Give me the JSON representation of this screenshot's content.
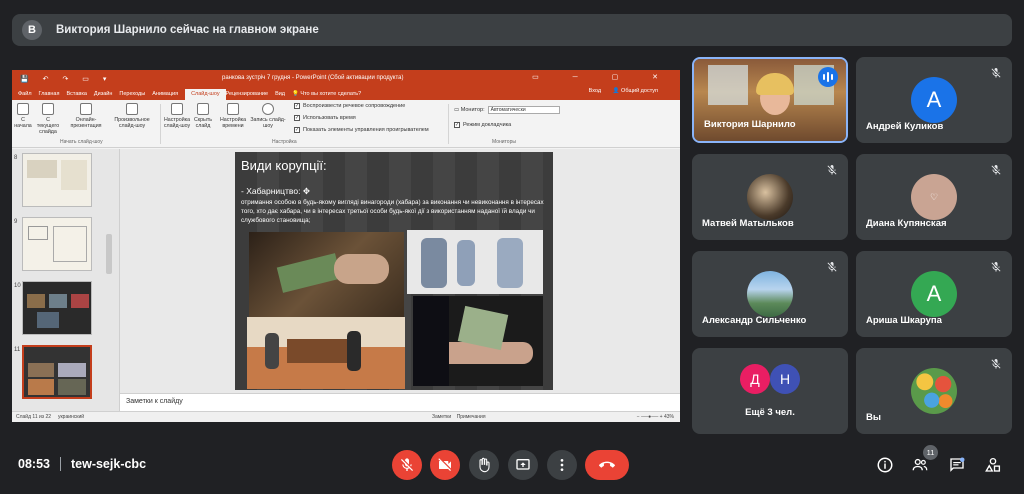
{
  "banner": {
    "avatar_letter": "B",
    "text": "Виктория Шарнило сейчас на главном экране"
  },
  "powerpoint": {
    "title_bar": "ранкова зустріч 7 грудня - PowerPoint (Сбой активации продукта)",
    "tabs": [
      "Файл",
      "Главная",
      "Вставка",
      "Дизайн",
      "Переходы",
      "Анимация",
      "Слайд-шоу",
      "Рецензирование",
      "Вид"
    ],
    "active_tab": "Слайд-шоу",
    "tell_me": "Что вы хотите сделать?",
    "sign_in": "Вход",
    "share": "Общий доступ",
    "ribbon": {
      "btn_start": "С начала",
      "btn_current": "С текущего слайда",
      "btn_online": "Онлайн-презентация",
      "btn_custom": "Произвольное слайд-шоу",
      "group_start": "Начать слайд-шоу",
      "btn_setup": "Настройка слайд-шоу",
      "btn_hide": "Скрыть слайд",
      "btn_timing": "Настройка времени",
      "btn_record": "Запись слайд-шоу",
      "check_narration": "Воспроизвести речевое сопровождение",
      "check_timings": "Использовать время",
      "check_controls": "Показать элементы управления проигрывателем",
      "group_setup": "Настройка",
      "monitor_label": "Монитор:",
      "monitor_value": "Автоматически",
      "check_presenter": "Режим докладчика",
      "group_monitors": "Мониторы"
    },
    "thumb_numbers": [
      "8",
      "9",
      "10",
      "11"
    ],
    "slide": {
      "title": "Види корупції:",
      "bullet": "-   Хабарництво:",
      "body": " отримання особою в будь-якому вигляді винагороди (хабара) за виконання чи невиконання в інтересах того, хто дає хабара, чи в інтересах третьої особи будь-якої дії з використанням наданої  їй влади чи службового становища;"
    },
    "notes": "Заметки к слайду",
    "status": {
      "slide": "Слайд 11 из 22",
      "lang": "украинский",
      "notes_btn": "Заметки",
      "comments_btn": "Примечания",
      "zoom": "43%"
    }
  },
  "participants": [
    {
      "name": "Виктория Шарнило",
      "speaking": true
    },
    {
      "name": "Андрей Куликов",
      "letter": "А",
      "color": "#1a73e8"
    },
    {
      "name": "Матвей Матыльков"
    },
    {
      "name": "Диана Купянская"
    },
    {
      "name": "Александр Сильченко"
    },
    {
      "name": "Ариша Шкарупа",
      "letter": "А",
      "color": "#34a853"
    },
    {
      "name": "Ещё 3 чел.",
      "letters": [
        "Д",
        "Н"
      ],
      "colors": [
        "#e91e63",
        "#3f51b5"
      ]
    },
    {
      "name": "Вы"
    }
  ],
  "bottom": {
    "time": "08:53",
    "meeting_code": "tew-sejk-cbc",
    "participant_count": "11"
  }
}
